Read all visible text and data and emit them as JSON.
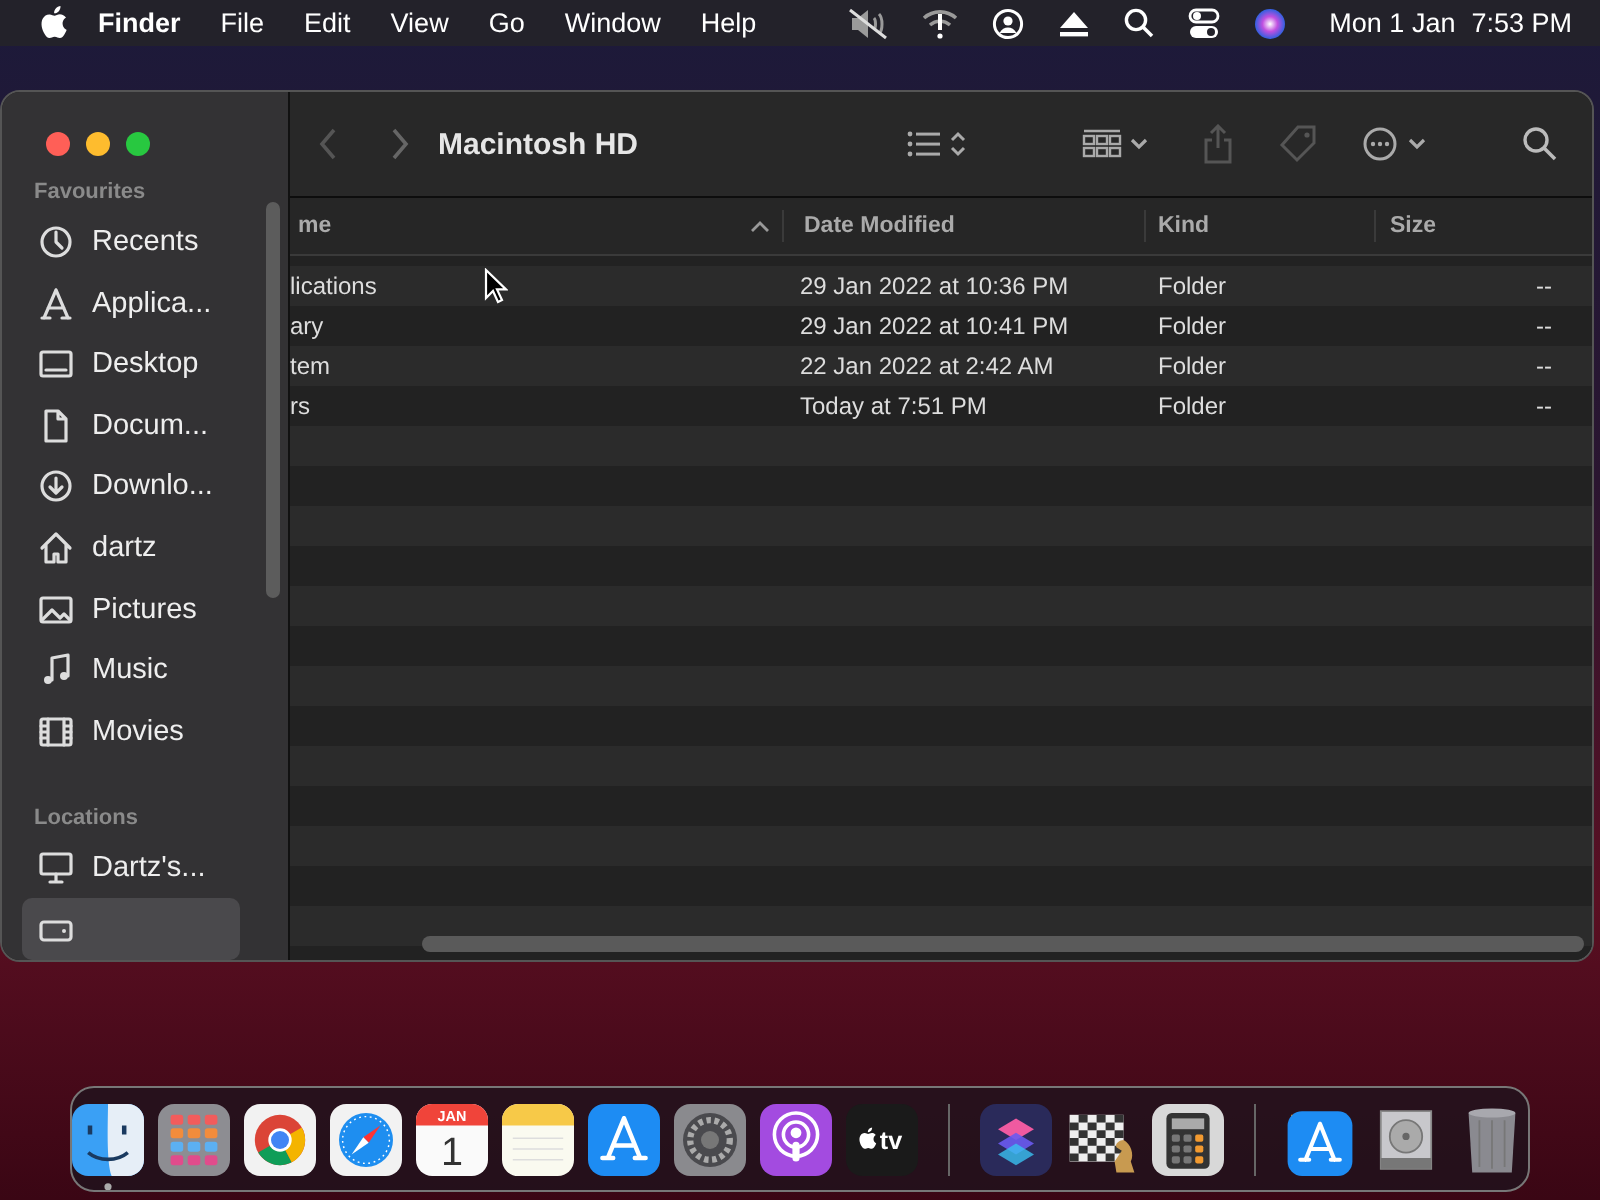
{
  "menu_bar": {
    "app_name": "Finder",
    "menus": [
      "File",
      "Edit",
      "View",
      "Go",
      "Window",
      "Help"
    ],
    "date": "Mon 1 Jan",
    "time": "7:53 PM"
  },
  "window": {
    "title": "Macintosh HD",
    "sidebar": {
      "sections": [
        {
          "heading": "Favourites",
          "items": [
            {
              "kind": "recents",
              "label": "Recents",
              "selected": false
            },
            {
              "kind": "applications",
              "label": "Applica...",
              "selected": false
            },
            {
              "kind": "desktop",
              "label": "Desktop",
              "selected": false
            },
            {
              "kind": "document",
              "label": "Docum...",
              "selected": false
            },
            {
              "kind": "downloads",
              "label": "Downlo...",
              "selected": false
            },
            {
              "kind": "home",
              "label": "dartz",
              "selected": false
            },
            {
              "kind": "pictures",
              "label": "Pictures",
              "selected": false
            },
            {
              "kind": "music",
              "label": "Music",
              "selected": false
            },
            {
              "kind": "movies",
              "label": "Movies",
              "selected": false
            }
          ]
        },
        {
          "heading": "Locations",
          "items": [
            {
              "kind": "computer",
              "label": "Dartz's...",
              "selected": false
            },
            {
              "kind": "drive",
              "selected": true
            }
          ]
        }
      ]
    },
    "table": {
      "columns": [
        {
          "label": "me",
          "sorted": true
        },
        {
          "label": "Date Modified",
          "sorted": false
        },
        {
          "label": "Kind",
          "sorted": false
        },
        {
          "label": "Size",
          "sorted": false
        }
      ],
      "rows": [
        [
          "lications",
          "29 Jan 2022 at 10:36 PM",
          "Folder",
          "--"
        ],
        [
          "ary",
          "29 Jan 2022 at 10:41 PM",
          "Folder",
          "--"
        ],
        [
          "tem",
          "22 Jan 2022 at 2:42 AM",
          "Folder",
          "--"
        ],
        [
          "rs",
          "Today at 7:51 PM",
          "Folder",
          "--"
        ]
      ]
    }
  },
  "dock": {
    "items": [
      {
        "kind": "finder",
        "running": true
      },
      {
        "kind": "launchpad",
        "running": false
      },
      {
        "kind": "chrome",
        "running": false
      },
      {
        "kind": "safari",
        "running": false
      },
      {
        "kind": "calendar",
        "running": false,
        "month": "JAN",
        "day": "1"
      },
      {
        "kind": "notes",
        "running": false
      },
      {
        "kind": "appstore",
        "running": false
      },
      {
        "kind": "settings",
        "running": false
      },
      {
        "kind": "podcasts",
        "running": false
      },
      {
        "kind": "tv",
        "running": false,
        "label": "tv"
      },
      {
        "kind": "separator"
      },
      {
        "kind": "shortcuts",
        "running": false
      },
      {
        "kind": "chess",
        "running": false
      },
      {
        "kind": "calculator",
        "running": false
      },
      {
        "kind": "separator"
      },
      {
        "kind": "downloads-stack",
        "running": false
      },
      {
        "kind": "disk",
        "running": false
      },
      {
        "kind": "trash",
        "running": false
      }
    ]
  }
}
